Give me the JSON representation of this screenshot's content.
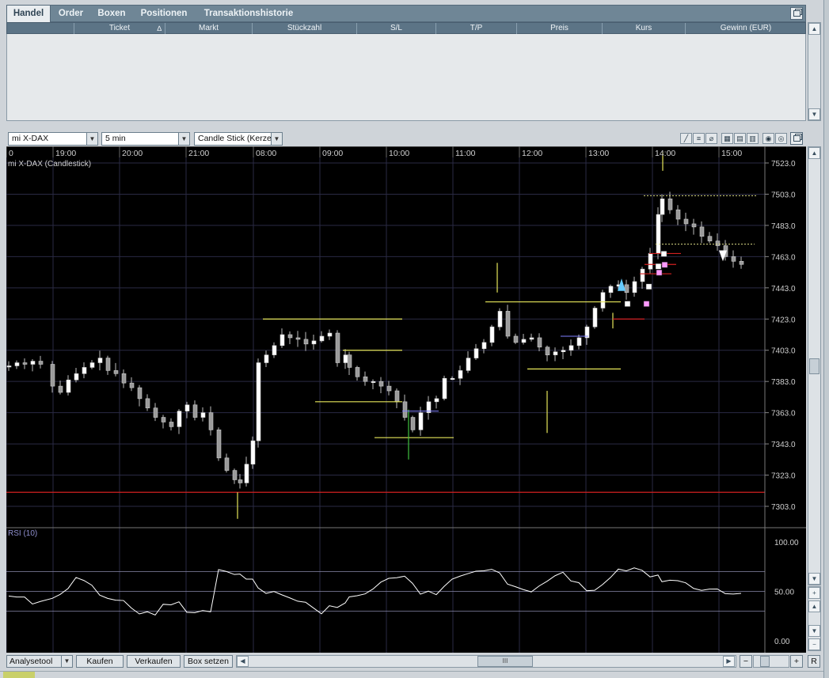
{
  "tabs": [
    {
      "label": "Handel",
      "active": true
    },
    {
      "label": "Order",
      "active": false
    },
    {
      "label": "Boxen",
      "active": false
    },
    {
      "label": "Positionen",
      "active": false
    },
    {
      "label": "Transaktionshistorie",
      "active": false
    }
  ],
  "columns": [
    "Ticket",
    "Markt",
    "Stückzahl",
    "S/L",
    "T/P",
    "Preis",
    "Kurs",
    "Gewinn (EUR)"
  ],
  "sort_indicator": "∆",
  "toolbar": {
    "instrument": "mi X-DAX",
    "interval": "5 min",
    "chart_type": "Candle Stick (Kerze"
  },
  "chart": {
    "title": "mi X-DAX (Candlestick)",
    "x_labels": [
      "0",
      "19:00",
      "20:00",
      "21:00",
      "08:00",
      "09:00",
      "10:00",
      "11:00",
      "12:00",
      "13:00",
      "14:00",
      "15:00"
    ],
    "y_labels": [
      "7523.0",
      "7503.0",
      "7483.0",
      "7463.0",
      "7443.0",
      "7423.0",
      "7403.0",
      "7383.0",
      "7363.0",
      "7343.0",
      "7323.0",
      "7303.0"
    ],
    "ylim": [
      7294,
      7533
    ],
    "red_level": 7312,
    "rsi": {
      "title": "RSI (10)",
      "y_labels": [
        "100.00",
        "50.00",
        "0.00"
      ],
      "levels": [
        70,
        50,
        30
      ]
    },
    "colors": {
      "up": "#ffffff",
      "down": "#9a9a9a",
      "grid": "#2a2a44",
      "yellow": "#e6e65a",
      "red": "#d22020",
      "accent": "#6f8696"
    }
  },
  "bottom": {
    "analysetool": "Analysetool",
    "kaufen": "Kaufen",
    "verkaufen": "Verkaufen",
    "box_setzen": "Box setzen",
    "thumb_label": "III",
    "zoom_minus": "−",
    "zoom_plus": "+",
    "reset": "R"
  },
  "side": {
    "plus": "+",
    "minus": "−"
  }
}
